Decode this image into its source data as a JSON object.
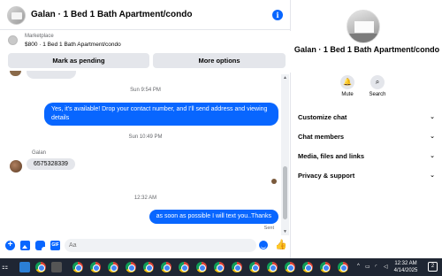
{
  "header": {
    "title": "Galan · 1 Bed 1 Bath Apartment/condo",
    "info_icon": "info-icon",
    "accent": "#0866ff"
  },
  "marketplace": {
    "source": "Marketplace",
    "listing": "$800 · 1 Bed 1 Bath Apartment/condo",
    "mark_pending_label": "Mark as pending",
    "more_options_label": "More options"
  },
  "thread": {
    "messages": [
      {
        "type": "timestamp",
        "text": "Sun 9:54 PM"
      },
      {
        "type": "outgoing",
        "text": "Yes, it's available! Drop your contact number, and I'll send address and viewing details"
      },
      {
        "type": "timestamp",
        "text": "Sun 10:49 PM"
      },
      {
        "type": "sender",
        "text": "Galan"
      },
      {
        "type": "incoming",
        "text": "6575328339"
      },
      {
        "type": "timestamp",
        "text": "12:32 AM"
      },
      {
        "type": "outgoing",
        "text": "as soon as possible I will text you..Thanks"
      },
      {
        "type": "status",
        "text": "Sent"
      }
    ]
  },
  "composer": {
    "placeholder": "Aa",
    "icons": [
      "plus-icon",
      "photo-icon",
      "sticker-icon",
      "gif-icon",
      "emoji-icon",
      "like-icon"
    ],
    "gif_label": "GIF"
  },
  "details": {
    "title": "Galan · 1 Bed 1 Bath Apartment/condo",
    "actions": [
      {
        "label": "Mute",
        "icon": "bell-icon"
      },
      {
        "label": "Search",
        "icon": "search-icon"
      }
    ],
    "menu": [
      {
        "label": "Customize chat"
      },
      {
        "label": "Chat members"
      },
      {
        "label": "Media, files and links"
      },
      {
        "label": "Privacy & support"
      }
    ]
  },
  "taskbar": {
    "time": "12:32 AM",
    "date": "4/14/2025",
    "notifications": "2"
  }
}
